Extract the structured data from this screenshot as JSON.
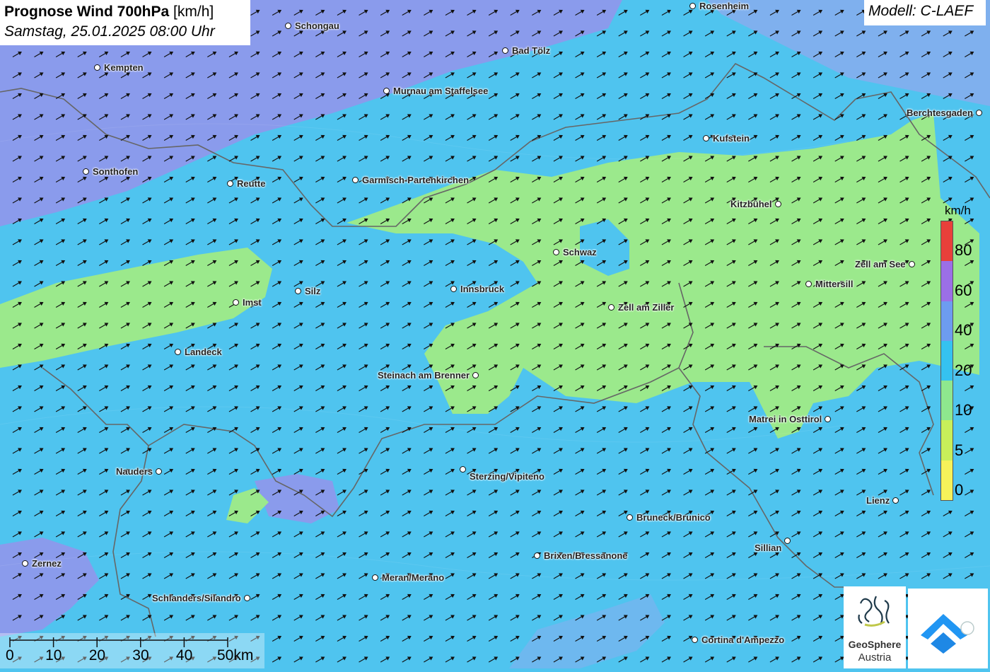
{
  "title": {
    "main": "Prognose Wind 700hPa",
    "unit": "[km/h]",
    "datetime": "Samstag, 25.01.2025 08:00 Uhr"
  },
  "model": "Modell: C-LAEF",
  "legend": {
    "unit": "km/h",
    "labels": [
      "80",
      "60",
      "40",
      "20",
      "10",
      "5",
      "0"
    ],
    "colors": [
      "#e8403a",
      "#9b6fe6",
      "#6d9cf0",
      "#35c2f0",
      "#8ee88e",
      "#c8ef5a",
      "#f6f25a"
    ]
  },
  "scale": {
    "ticks": [
      "0",
      "10",
      "20",
      "30",
      "40",
      "50km"
    ]
  },
  "logos": {
    "brand_name": "GeoSphere",
    "brand_sub": "Austria",
    "icons": [
      "geosphere-logo-icon",
      "app-cloud-logo-icon"
    ]
  },
  "map": {
    "wind_direction": "west-southwest",
    "colors": {
      "light_blue": "#4fc4ef",
      "purple": "#8a9bec",
      "green": "#9be98c",
      "border": "#666666"
    },
    "cities": [
      {
        "name": "Rosenheim"
      },
      {
        "name": "Schongau"
      },
      {
        "name": "Bad Tölz"
      },
      {
        "name": "Kempten"
      },
      {
        "name": "Murnau am Staffelsee"
      },
      {
        "name": "Berchtesgaden"
      },
      {
        "name": "Kufstein"
      },
      {
        "name": "Sonthofen"
      },
      {
        "name": "Reutte"
      },
      {
        "name": "Garmisch-Partenkirchen"
      },
      {
        "name": "Kitzbühel"
      },
      {
        "name": "Schwaz"
      },
      {
        "name": "Zell am See"
      },
      {
        "name": "Mittersill"
      },
      {
        "name": "Silz"
      },
      {
        "name": "Innsbruck"
      },
      {
        "name": "Imst"
      },
      {
        "name": "Zell am Ziller"
      },
      {
        "name": "Landeck"
      },
      {
        "name": "Steinach am Brenner"
      },
      {
        "name": "Matrei in Osttirol"
      },
      {
        "name": "Nauders"
      },
      {
        "name": "Sterzing/Vipiteno"
      },
      {
        "name": "Lienz"
      },
      {
        "name": "Bruneck/Brunico"
      },
      {
        "name": "Sillian"
      },
      {
        "name": "Brixen/Bressanone"
      },
      {
        "name": "Zernez"
      },
      {
        "name": "Meran/Merano"
      },
      {
        "name": "Schlanders/Silandro"
      },
      {
        "name": "Cortina d'Ampezzo"
      }
    ]
  }
}
